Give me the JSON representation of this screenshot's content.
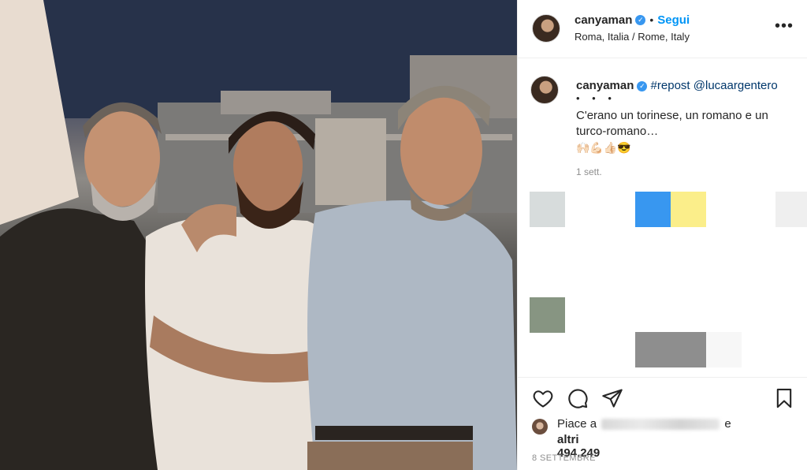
{
  "post": {
    "username": "canyaman",
    "follow_label": "Segui",
    "location": "Roma, Italia / Rome, Italy",
    "more_label": "•••",
    "caption": {
      "username": "canyaman",
      "hashtag": "#repost",
      "mention": "@lucaargentero",
      "dots": "• • •",
      "text": "C'erano un torinese, un romano e un turco-romano…",
      "emoji": "🙌🏻💪🏻👍🏻😎",
      "time_ago": "1 sett."
    },
    "likes": {
      "prefix": "Piace a",
      "suffix": "e",
      "count_text": "altri 494.249"
    },
    "date": "8 SETTEMBRE"
  },
  "colors": {
    "accent": "#0095f6",
    "verified": "#3897f0",
    "block_blue": "#3897f0",
    "block_yellow": "#fbee8a",
    "block_gray": "#d7dcdc",
    "block_green": "#879582",
    "block_dark_gray": "#8e8e8e"
  },
  "icons": [
    "heart-icon",
    "comment-icon",
    "share-icon",
    "bookmark-icon",
    "verified-badge-icon",
    "more-options-icon"
  ]
}
